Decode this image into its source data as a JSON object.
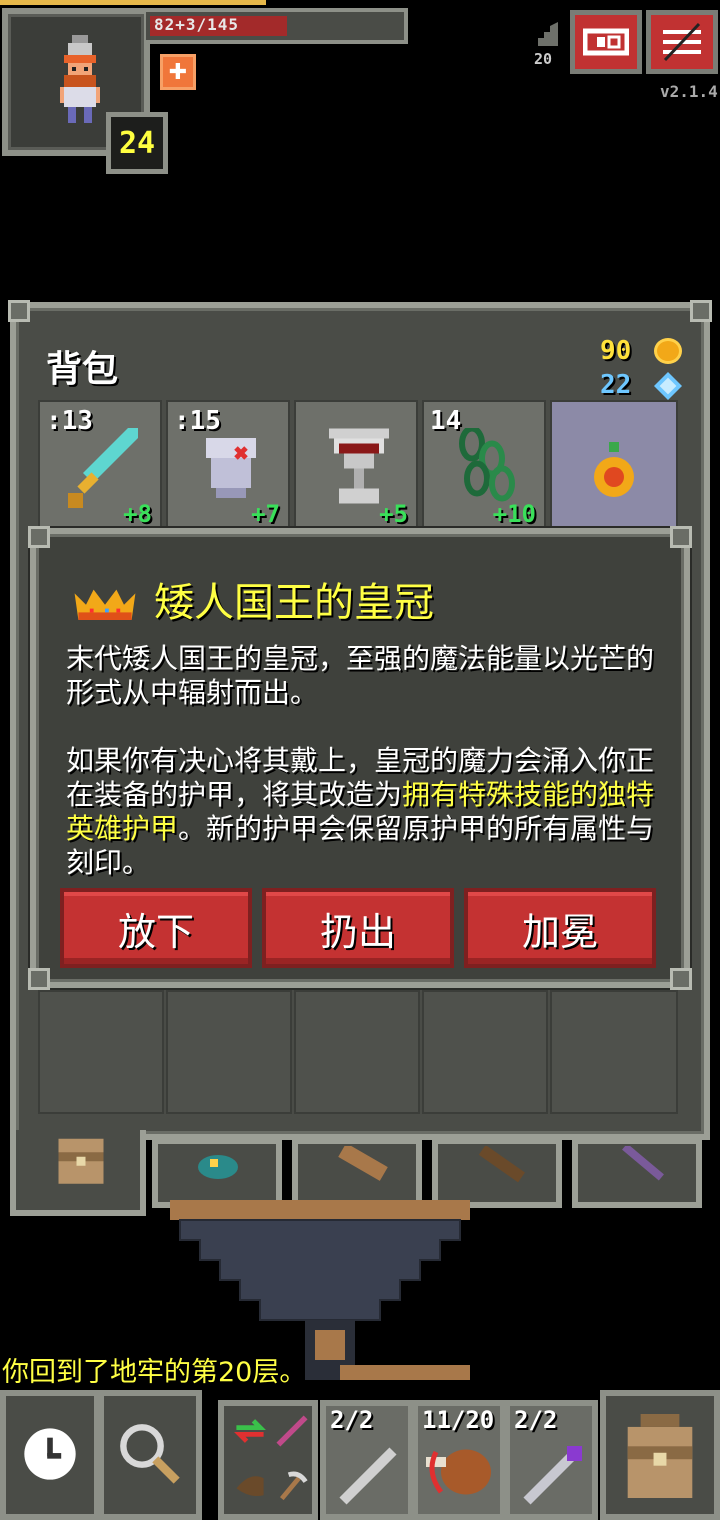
{
  "hud": {
    "hp_text": "82+3/145",
    "level": "24",
    "depth": "20",
    "version": "v2.1.4",
    "hp_fraction": 0.57,
    "xp_fraction": 0.37
  },
  "backpack": {
    "title": "背包",
    "gold": "90",
    "gems": "22",
    "slots": [
      {
        "icon": "sword-icon",
        "qty": ":13",
        "level": "+8"
      },
      {
        "icon": "armor-icon",
        "qty": ":15",
        "level": "+7"
      },
      {
        "icon": "chalice-icon",
        "qty": "",
        "level": "+5"
      },
      {
        "icon": "chain-icon",
        "qty": "14",
        "level": "+10"
      },
      {
        "icon": "amulet-icon",
        "qty": "",
        "level": ""
      }
    ]
  },
  "item_info": {
    "title": "矮人国王的皇冠",
    "desc_p1": "末代矮人国王的皇冠，至强的魔法能量以光芒的形式从中辐射而出。",
    "desc_p2_a": "如果你有决心将其戴上，皇冠的魔力会涌入你正在装备的护甲，将其改造为",
    "desc_p2_hl": "拥有特殊技能的独特英雄护甲",
    "desc_p2_b": "。新的护甲会保留原护甲的所有属性与刻印。",
    "buttons": {
      "drop": "放下",
      "throw": "扔出",
      "crown": "加冕"
    }
  },
  "log": {
    "message": "你回到了地牢的第20层。"
  },
  "toolbar": {
    "quickslots": [
      {
        "icon": "wand-icon",
        "qty": "2/2"
      },
      {
        "icon": "meat-icon",
        "qty": "11/20"
      },
      {
        "icon": "staff-icon",
        "qty": "2/2"
      }
    ]
  },
  "colors": {
    "accent_yellow": "#ffff44",
    "button_red": "#c43232",
    "panel": "#4a4c47",
    "border": "#9c9f96"
  }
}
